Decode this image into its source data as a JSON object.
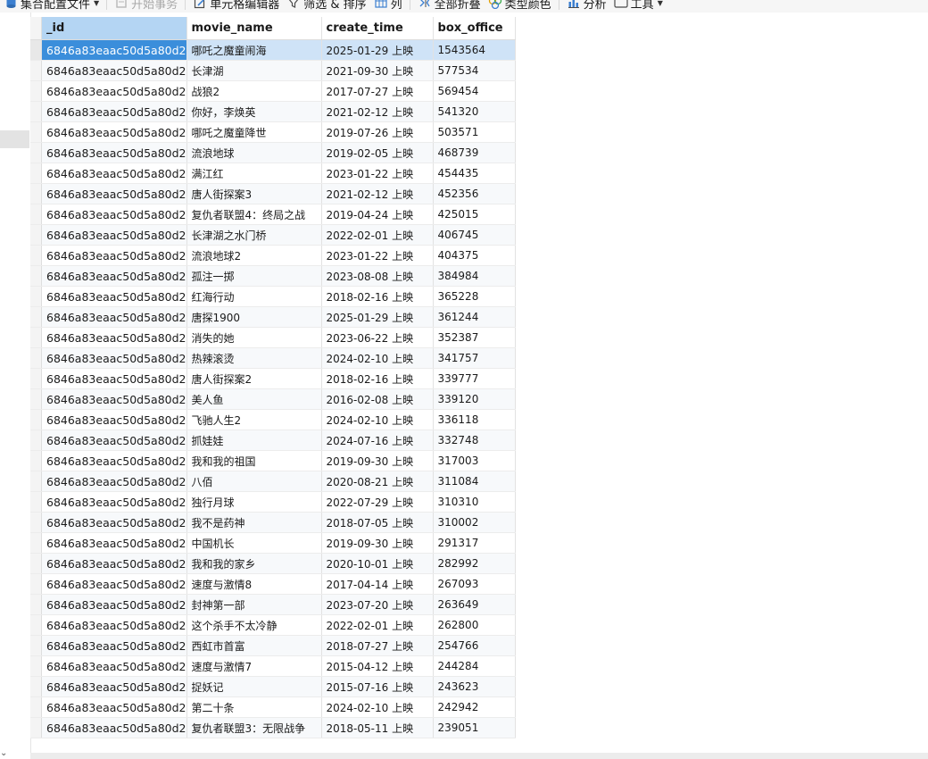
{
  "toolbar": {
    "items": [
      {
        "label": "集合配置文件",
        "icon": "collection-icon",
        "has_dropdown": true,
        "enabled": true
      },
      {
        "label": "开始事务",
        "icon": "transaction-icon",
        "enabled": false
      },
      {
        "label": "单元格编辑器",
        "icon": "cell-editor-icon",
        "enabled": true
      },
      {
        "label": "筛选 & 排序",
        "icon": "filter-icon",
        "enabled": true
      },
      {
        "label": "列",
        "icon": "columns-icon",
        "enabled": true
      },
      {
        "label": "全部折叠",
        "icon": "collapse-icon",
        "enabled": true
      },
      {
        "label": "类型颜色",
        "icon": "palette-icon",
        "enabled": true
      },
      {
        "label": "分析",
        "icon": "chart-icon",
        "enabled": true
      },
      {
        "label": "工具",
        "icon": "tools-icon",
        "has_dropdown": true,
        "enabled": true
      }
    ]
  },
  "grid": {
    "columns": [
      "_id",
      "movie_name",
      "create_time",
      "box_office"
    ],
    "selected_row": 0,
    "rows": [
      [
        "6846a83eaac50d5a80d2",
        "哪吒之魔童闹海",
        "2025-01-29 上映",
        "1543564"
      ],
      [
        "6846a83eaac50d5a80d2",
        "长津湖",
        "2021-09-30 上映",
        "577534"
      ],
      [
        "6846a83eaac50d5a80d2",
        "战狼2",
        "2017-07-27 上映",
        "569454"
      ],
      [
        "6846a83eaac50d5a80d2",
        "你好，李焕英",
        "2021-02-12 上映",
        "541320"
      ],
      [
        "6846a83eaac50d5a80d2",
        "哪吒之魔童降世",
        "2019-07-26 上映",
        "503571"
      ],
      [
        "6846a83eaac50d5a80d2",
        "流浪地球",
        "2019-02-05 上映",
        "468739"
      ],
      [
        "6846a83eaac50d5a80d2",
        "满江红",
        "2023-01-22 上映",
        "454435"
      ],
      [
        "6846a83eaac50d5a80d2",
        "唐人街探案3",
        "2021-02-12 上映",
        "452356"
      ],
      [
        "6846a83eaac50d5a80d2",
        "复仇者联盟4：终局之战",
        "2019-04-24 上映",
        "425015"
      ],
      [
        "6846a83eaac50d5a80d2",
        "长津湖之水门桥",
        "2022-02-01 上映",
        "406745"
      ],
      [
        "6846a83eaac50d5a80d2",
        "流浪地球2",
        "2023-01-22 上映",
        "404375"
      ],
      [
        "6846a83eaac50d5a80d2",
        "孤注一掷",
        "2023-08-08 上映",
        "384984"
      ],
      [
        "6846a83eaac50d5a80d2",
        "红海行动",
        "2018-02-16 上映",
        "365228"
      ],
      [
        "6846a83eaac50d5a80d2",
        "唐探1900",
        "2025-01-29 上映",
        "361244"
      ],
      [
        "6846a83eaac50d5a80d2",
        "消失的她",
        "2023-06-22 上映",
        "352387"
      ],
      [
        "6846a83eaac50d5a80d2",
        "热辣滚烫",
        "2024-02-10 上映",
        "341757"
      ],
      [
        "6846a83eaac50d5a80d2",
        "唐人街探案2",
        "2018-02-16 上映",
        "339777"
      ],
      [
        "6846a83eaac50d5a80d2",
        "美人鱼",
        "2016-02-08 上映",
        "339120"
      ],
      [
        "6846a83eaac50d5a80d2",
        "飞驰人生2",
        "2024-02-10 上映",
        "336118"
      ],
      [
        "6846a83eaac50d5a80d2",
        "抓娃娃",
        "2024-07-16 上映",
        "332748"
      ],
      [
        "6846a83eaac50d5a80d2",
        "我和我的祖国",
        "2019-09-30 上映",
        "317003"
      ],
      [
        "6846a83eaac50d5a80d2",
        "八佰",
        "2020-08-21 上映",
        "311084"
      ],
      [
        "6846a83eaac50d5a80d2",
        "独行月球",
        "2022-07-29 上映",
        "310310"
      ],
      [
        "6846a83eaac50d5a80d2",
        "我不是药神",
        "2018-07-05 上映",
        "310002"
      ],
      [
        "6846a83eaac50d5a80d2",
        "中国机长",
        "2019-09-30 上映",
        "291317"
      ],
      [
        "6846a83eaac50d5a80d2",
        "我和我的家乡",
        "2020-10-01 上映",
        "282992"
      ],
      [
        "6846a83eaac50d5a80d2",
        "速度与激情8",
        "2017-04-14 上映",
        "267093"
      ],
      [
        "6846a83eaac50d5a80d2",
        "封神第一部",
        "2023-07-20 上映",
        "263649"
      ],
      [
        "6846a83eaac50d5a80d2",
        "这个杀手不太冷静",
        "2022-02-01 上映",
        "262800"
      ],
      [
        "6846a83eaac50d5a80d2",
        "西虹市首富",
        "2018-07-27 上映",
        "254766"
      ],
      [
        "6846a83eaac50d5a80d2",
        "速度与激情7",
        "2015-04-12 上映",
        "244284"
      ],
      [
        "6846a83eaac50d5a80d2",
        "捉妖记",
        "2015-07-16 上映",
        "243623"
      ],
      [
        "6846a83eaac50d5a80d2",
        "第二十条",
        "2024-02-10 上映",
        "242942"
      ],
      [
        "6846a83eaac50d5a80d2",
        "复仇者联盟3：无限战争",
        "2018-05-11 上映",
        "239051"
      ]
    ]
  },
  "colors": {
    "header_selected": "#b4d5f3",
    "row_selected": "#cfe3f7",
    "cell_selected": "#3b8edb"
  }
}
